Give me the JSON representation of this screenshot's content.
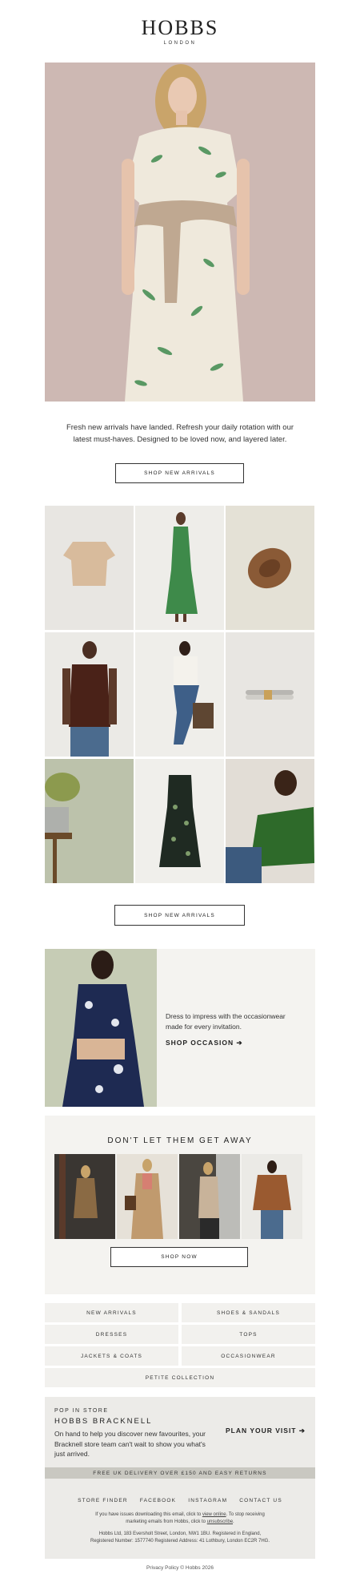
{
  "brand": {
    "name": "HOBBS",
    "tagline": "LONDON"
  },
  "hero": {
    "intro": "Fresh new arrivals have landed. Refresh your daily rotation with our latest must-haves. Designed to be loved now, and layered later.",
    "button": "SHOP NEW ARRIVALS"
  },
  "grid": {
    "button": "SHOP NEW ARRIVALS"
  },
  "occasion": {
    "text": "Dress to impress with the occasionwear made for every invitation.",
    "link": "SHOP OCCASION ➔"
  },
  "dont_miss": {
    "title": "DON'T LET THEM GET AWAY",
    "button": "SHOP NOW"
  },
  "nav": [
    "NEW ARRIVALS",
    "SHOES & SANDALS",
    "DRESSES",
    "TOPS",
    "JACKETS & COATS",
    "OCCASIONWEAR",
    "PETITE COLLECTION"
  ],
  "store": {
    "kicker": "POP IN STORE",
    "name": "HOBBS BRACKNELL",
    "text": "On hand to help you discover new favourites, your Bracknell store team can't wait to show you what's just arrived.",
    "cta": "PLAN YOUR VISIT ➔"
  },
  "delivery": "FREE UK DELIVERY OVER £150 AND EASY RETURNS",
  "footer": {
    "links": [
      "STORE FINDER",
      "FACEBOOK",
      "INSTAGRAM",
      "CONTACT US"
    ],
    "note1_a": "If you have issues downloading this email, click to ",
    "note1_link": "view online",
    "note1_b": ". To stop receiving",
    "note2_a": "marketing emails from Hobbs, click to ",
    "note2_link": "unsubscribe",
    "note2_b": ".",
    "address1": "Hobbs Ltd, 183 Eversholt Street, London, NW1 1BU. Registered in England,",
    "address2": "Registered Number: 1577740 Registered Address: 41 Lothbury, London EC2R 7HG.",
    "privacy": "Privacy Policy © Hobbs 2026"
  }
}
